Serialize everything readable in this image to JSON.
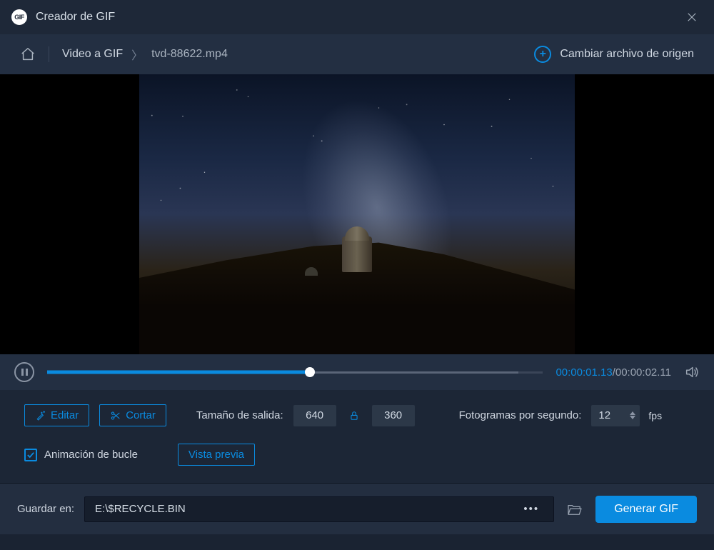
{
  "titlebar": {
    "title": "Creador de GIF"
  },
  "breadcrumb": {
    "link": "Video a GIF",
    "file": "tvd-88622.mp4"
  },
  "change_source": {
    "label": "Cambiar archivo de origen"
  },
  "playback": {
    "current": "00:00:01.13",
    "duration": "00:00:02.11",
    "progress_pct": 53
  },
  "settings": {
    "edit_label": "Editar",
    "cut_label": "Cortar",
    "output_size_label": "Tamaño de salida:",
    "width": "640",
    "height": "360",
    "fps_label": "Fotogramas por segundo:",
    "fps_value": "12",
    "fps_unit": "fps",
    "loop_label": "Animación de bucle",
    "loop_checked": true,
    "preview_label": "Vista previa"
  },
  "footer": {
    "save_label": "Guardar en:",
    "path": "E:\\$RECYCLE.BIN",
    "generate_label": "Generar GIF"
  }
}
